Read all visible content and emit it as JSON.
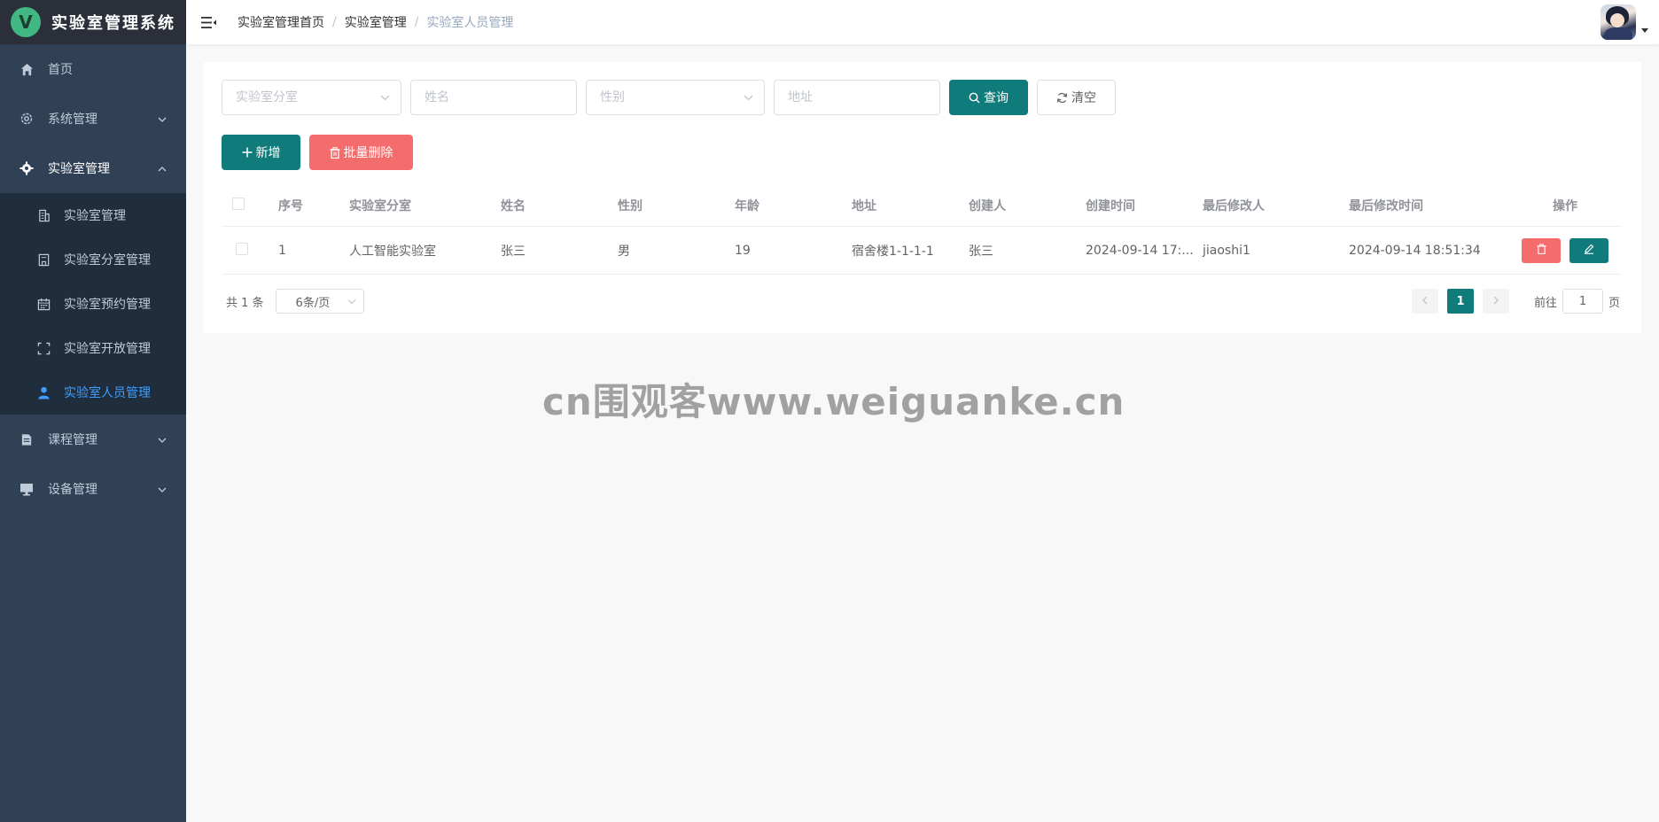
{
  "app": {
    "logo_letter": "V",
    "title": "实验室管理系统"
  },
  "sidebar": {
    "items": [
      {
        "label": "首页",
        "icon": "home-icon"
      },
      {
        "label": "系统管理",
        "icon": "gear-outline-icon"
      },
      {
        "label": "实验室管理",
        "icon": "gear-icon"
      },
      {
        "label": "课程管理",
        "icon": "document-icon"
      },
      {
        "label": "设备管理",
        "icon": "monitor-icon"
      }
    ],
    "lab_submenu": [
      {
        "label": "实验室管理",
        "icon": "building-icon"
      },
      {
        "label": "实验室分室管理",
        "icon": "office-icon"
      },
      {
        "label": "实验室预约管理",
        "icon": "calendar-icon"
      },
      {
        "label": "实验室开放管理",
        "icon": "fullscreen-icon"
      },
      {
        "label": "实验室人员管理",
        "icon": "user-icon"
      }
    ]
  },
  "header": {
    "breadcrumb": [
      "实验室管理首页",
      "实验室管理",
      "实验室人员管理"
    ]
  },
  "filters": {
    "room_placeholder": "实验室分室",
    "name_placeholder": "姓名",
    "gender_placeholder": "性别",
    "address_placeholder": "地址",
    "search_label": "查询",
    "clear_label": "清空"
  },
  "actions": {
    "add_label": "新增",
    "batch_delete_label": "批量删除"
  },
  "table": {
    "columns": [
      "序号",
      "实验室分室",
      "姓名",
      "性别",
      "年龄",
      "地址",
      "创建人",
      "创建时间",
      "最后修改人",
      "最后修改时间",
      "操作"
    ],
    "rows": [
      [
        "1",
        "人工智能实验室",
        "张三",
        "男",
        "19",
        "宿舍楼1-1-1-1",
        "张三",
        "2024-09-14 17:...",
        "jiaoshi1",
        "2024-09-14 18:51:34"
      ]
    ]
  },
  "pagination": {
    "total": "共 1 条",
    "page_size": "6条/页",
    "current_page": "1",
    "goto_prefix": "前往",
    "goto_value": "1",
    "goto_suffix": "页"
  },
  "watermark": "cn围观客www.weiguanke.cn",
  "colors": {
    "primary": "#0f7b7b",
    "danger": "#f56c6c",
    "sidebar": "#304156",
    "sidebar_active": "#409eff"
  }
}
